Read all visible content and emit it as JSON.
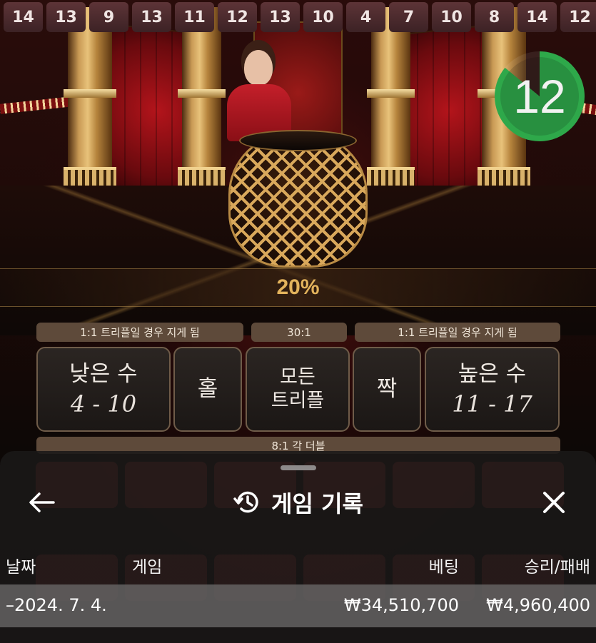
{
  "results": [
    "14",
    "13",
    "9",
    "13",
    "11",
    "12",
    "13",
    "10",
    "4",
    "7",
    "10",
    "8",
    "14",
    "12"
  ],
  "timer": {
    "value": "12",
    "remaining_fraction": 0.86
  },
  "multiplier_bar": {
    "text": "20%"
  },
  "payouts": {
    "low_side": "1:1 트리플일 경우 지게 됨",
    "any_triple": "30:1",
    "high_side": "1:1 트리플일 경우 지게 됨",
    "each_double": "8:1 각 더블"
  },
  "bets": {
    "low": {
      "title": "낮은 수",
      "range": "4 - 10"
    },
    "odd": {
      "title": "홀"
    },
    "any_triple": {
      "line1": "모든",
      "line2": "트리플"
    },
    "even": {
      "title": "짝"
    },
    "high": {
      "title": "높은 수",
      "range": "11 - 17"
    }
  },
  "history": {
    "title": "게임 기록",
    "columns": {
      "date": "날짜",
      "game": "게임",
      "bet": "베팅",
      "win_loss": "승리/패배"
    },
    "rows": [
      {
        "date": "–2024. 7. 4.",
        "game": "",
        "bet": "₩34,510,700",
        "win_loss": "₩4,960,400"
      }
    ]
  },
  "icons": {
    "back": "arrow-left-icon",
    "history": "history-clock-icon",
    "close": "close-icon"
  },
  "colors": {
    "timer_green": "#2ea84a",
    "gold": "#e3b35c",
    "result_tile": "#4a2a2d"
  }
}
